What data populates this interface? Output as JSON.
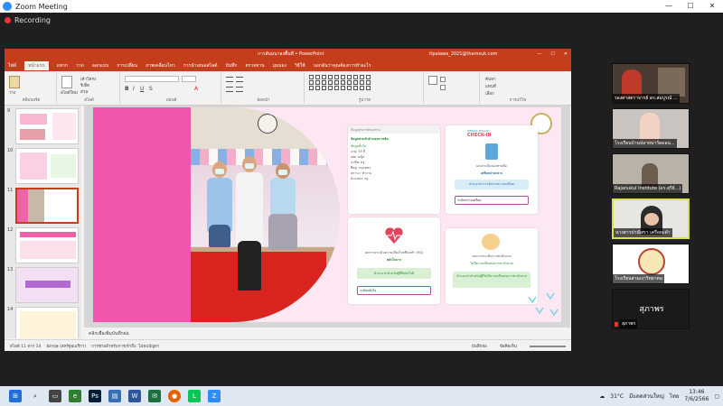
{
  "zoom": {
    "title": "Zoom Meeting",
    "recording": "Recording",
    "controls": [
      "—",
      "☐",
      "✕"
    ]
  },
  "powerpoint": {
    "filename": "การสัมมนาลงพื้นที่ • PowerPoint",
    "user": "itpalawa_2021@thamsuk.com",
    "tabs": [
      "ไฟล์",
      "หน้าแรก",
      "แทรก",
      "วาด",
      "ออกแบบ",
      "การเปลี่ยน",
      "ภาพเคลื่อนไหว",
      "การนำเสนอสไลด์",
      "บันทึก",
      "ตรวจทาน",
      "มุมมอง",
      "วิธีใช้",
      "บอกฉันว่าคุณต้องการทำอะไร"
    ],
    "ribbon_groups": [
      "คลิปบอร์ด",
      "สไลด์",
      "ฟอนต์",
      "ย่อหน้า",
      "รูปวาด",
      "การแก้ไข"
    ],
    "ribbon_buttons": {
      "paste": "วาง",
      "new_slide": "สไลด์ใหม่",
      "layout": "เค้าโครง",
      "reset": "รีเซ็ต",
      "section": "ส่วน",
      "find": "ค้นหา",
      "replace": "แทนที่",
      "select": "เลือก"
    },
    "slide_numbers": [
      "9",
      "10",
      "11",
      "12",
      "13",
      "14"
    ],
    "selected_slide": "11",
    "notes_placeholder": "คลิกเพื่อเพิ่มบันทึกย่อ",
    "status_left": "สไลด์ 11 จาก 14",
    "status_lang": "อังกฤษ (สหรัฐอเมริกา)",
    "status_accessibility": "การช่วยสำหรับการเข้าถึง: ไม่พบปัญหา",
    "status_notes": "บันทึกย่อ",
    "status_comments": "ข้อคิดเห็น"
  },
  "slide": {
    "card1_header": "ข้อมูลสุขภาพของท่าน",
    "card1_title": "ข้อมูลส่วนตัวด้านสุขภาพจิต",
    "card1_sub": "ข้อมูลทั่วไป",
    "card1_rows": [
      "อายุ: 35 ปี",
      "เพศ: หญิง",
      "อาชีพ: ครู",
      "ที่อยู่: กรุงเทพฯ",
      "สถานะ: ทำงาน",
      "ตำแหน่ง: ครู"
    ],
    "card2_title": "ผลประเมินของท่านคือ",
    "card2_result": "เครียดปานกลาง",
    "card2_button": "คำแนะนำการจัดการความเครียด",
    "card2_select": "ระดับความเครียด",
    "card3_text": "ผลการประเมินความเสี่ยงโรคซึมเศร้า (9Q)",
    "card3_result": "พลังใจมาก",
    "card3_button": "คำแนะนำสำหรับผู้ที่มีพลังใจดี",
    "card3_select": "ระดับพลังใจ",
    "card4_text": "ผลการประเมินการฆ่าตัวตาย",
    "card4_result": "ไม่มีความเสี่ยงต่อการฆ่าตัวตาย",
    "card4_button": "คำแนะนำสำหรับผู้ที่ไม่มีความเสี่ยงต่อการฆ่าตัวตาย",
    "brand_top": "MENTAL HEALTH",
    "brand_main": "CHECK-IN"
  },
  "participants": [
    {
      "name": "รองศาสตราจารย์ ดร.สมบูรณ์ ...",
      "bg": "#4a3b33"
    },
    {
      "name": "โรงเรียนบ้านปลายนาวัดดอน...",
      "bg": "#c9c4c0"
    },
    {
      "name": "Rajanukul Institute (ดร.สุรีย์...)",
      "bg": "#b8b2a8"
    },
    {
      "name": "นางสาวปาณิสรา เครือยะคำ",
      "bg": "#e8e6e0"
    },
    {
      "name": "โรงเรียนสามเงาวิทยาคม",
      "bg": "#ffffff"
    },
    {
      "name": "สุภาพร",
      "bg": "#1a1a1a"
    }
  ],
  "taskbar": {
    "temperature": "31°C",
    "weather": "มีแดดส่วนใหญ่",
    "lang": "ไทย",
    "time": "13:46",
    "date": "7/6/2566"
  },
  "colors": {
    "ppt_red": "#c43e1c",
    "slide_pink": "#f056ae",
    "zoom_blue": "#2d8cff"
  }
}
